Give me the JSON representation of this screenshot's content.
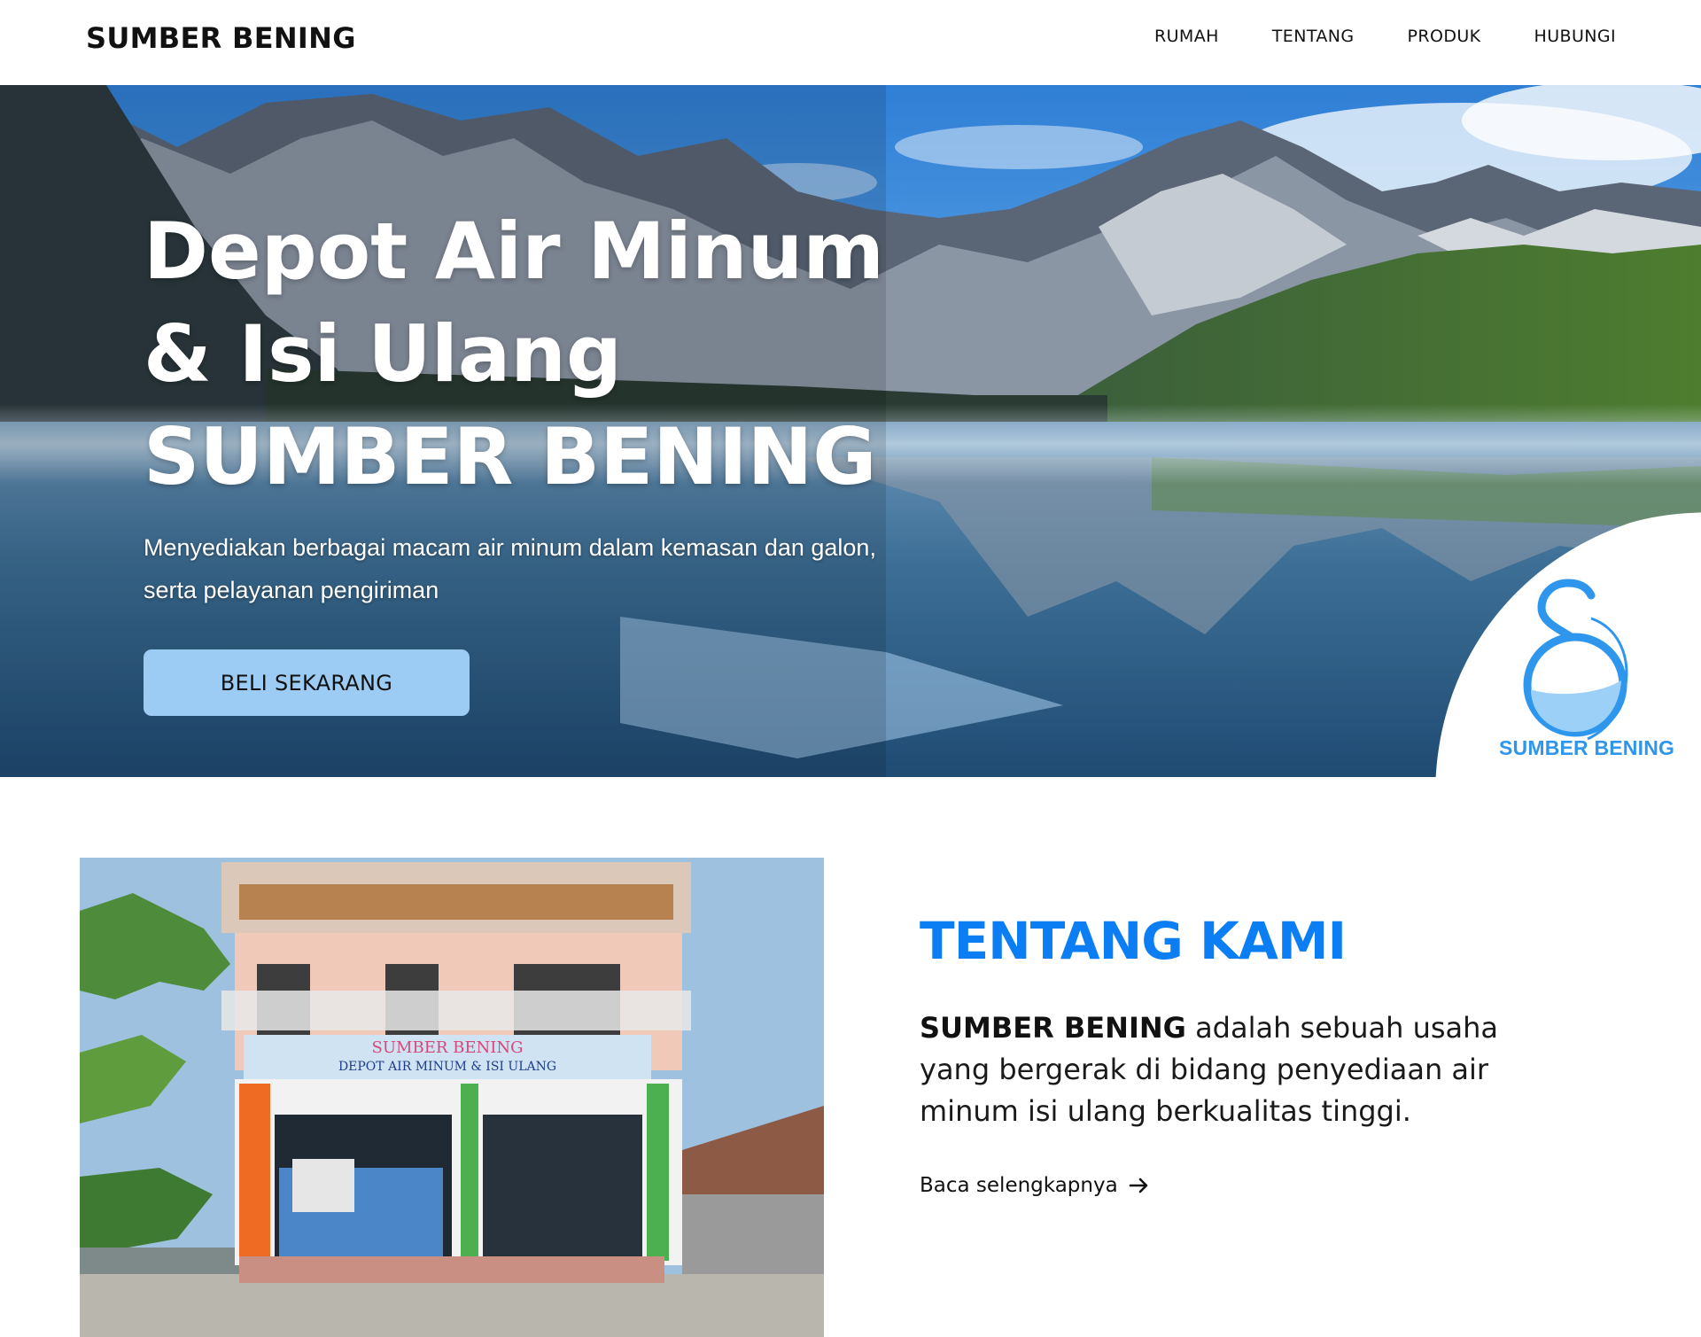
{
  "header": {
    "brand": "SUMBER BENING",
    "nav": [
      "RUMAH",
      "TENTANG",
      "PRODUK",
      "HUBUNGI"
    ]
  },
  "hero": {
    "title_lines": [
      "Depot Air Minum",
      "& Isi Ulang",
      "SUMBER BENING"
    ],
    "subtitle": "Menyediakan berbagai macam air minum dalam kemasan dan galon, serta pelayanan pengiriman",
    "cta_label": "BELI SEKARANG",
    "logo_text": "SUMBER BENING",
    "background_icon": "mountain-lake-photo"
  },
  "about": {
    "title": "TENTANG KAMI",
    "text_bold": "SUMBER BENING",
    "text_rest": " adalah sebuah usaha yang bergerak di bidang penyediaan air minum isi ulang berkualitas tinggi.",
    "link_label": "Baca selengkapnya",
    "link_icon": "arrow-right-icon",
    "photo_banner_title": "SUMBER BENING",
    "photo_banner_sub": "DEPOT AIR MINUM & ISI ULANG"
  },
  "colors": {
    "accent": "#0a7ef2",
    "button": "#9cccf3",
    "logo": "#2f96ee"
  }
}
